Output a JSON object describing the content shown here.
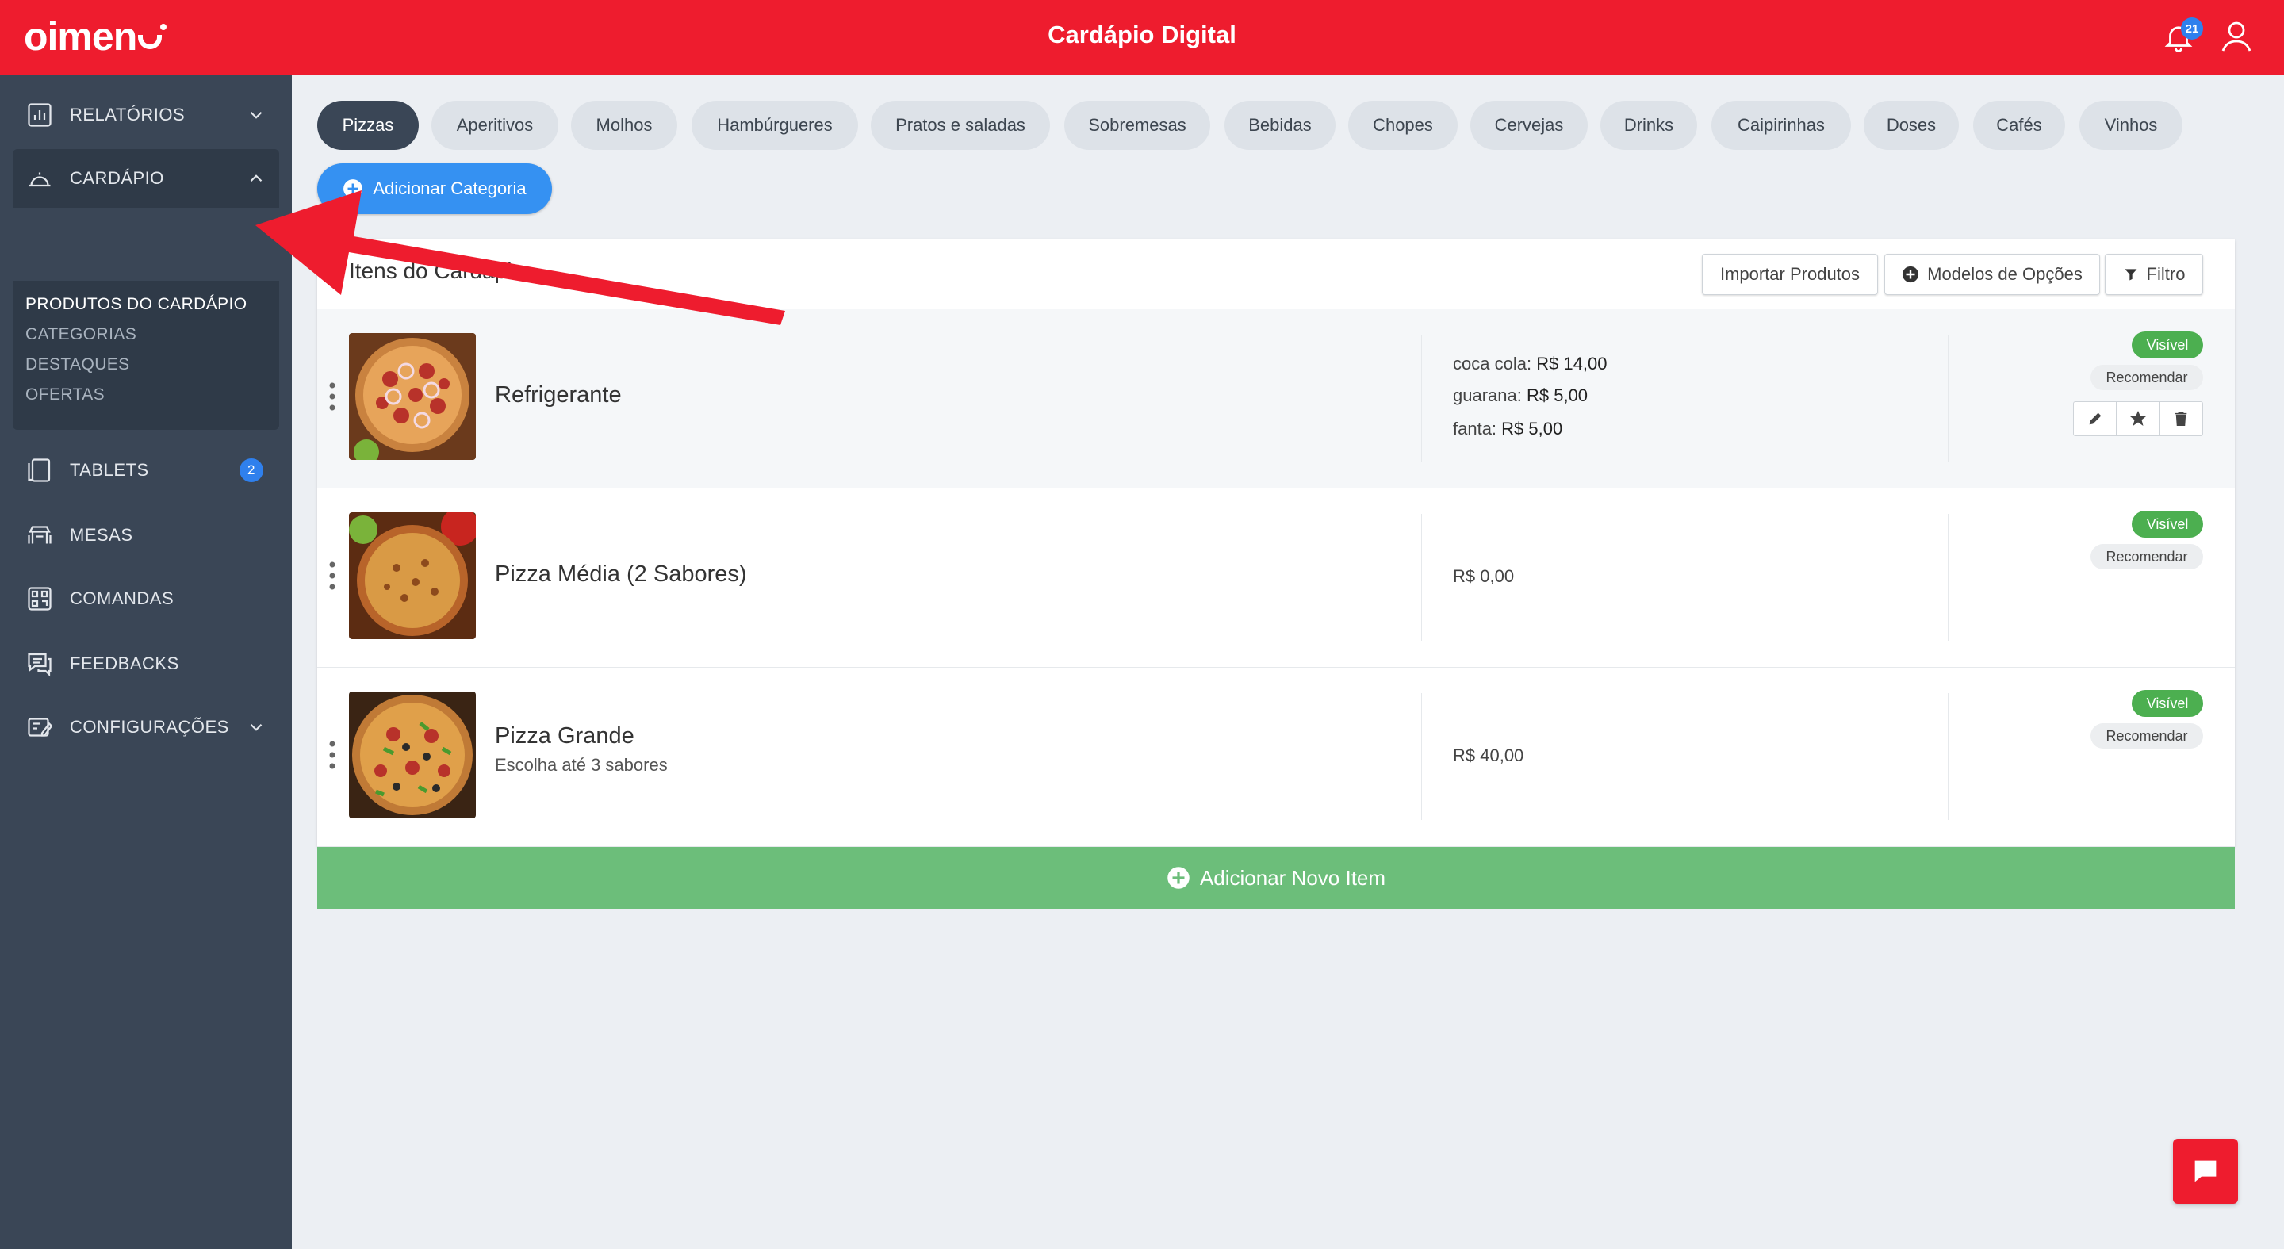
{
  "app": {
    "logo_text": "oimen",
    "title": "Cardápio Digital",
    "notification_count": "21"
  },
  "sidebar": {
    "items": [
      {
        "label": "RELATÓRIOS",
        "icon": "chart-icon"
      },
      {
        "label": "CARDÁPIO",
        "icon": "cloche-icon"
      },
      {
        "label": "TABLETS",
        "icon": "tablet-icon",
        "badge": "2"
      },
      {
        "label": "MESAS",
        "icon": "table-icon"
      },
      {
        "label": "COMANDAS",
        "icon": "qrcode-icon"
      },
      {
        "label": "FEEDBACKS",
        "icon": "chat-icon"
      },
      {
        "label": "CONFIGURAÇÕES",
        "icon": "settings-icon"
      }
    ],
    "subitems": [
      {
        "label": "PRODUTOS DO CARDÁPIO",
        "active": true
      },
      {
        "label": "CATEGORIAS"
      },
      {
        "label": "DESTAQUES"
      },
      {
        "label": "OFERTAS"
      }
    ]
  },
  "categories": [
    "Pizzas",
    "Aperitivos",
    "Molhos",
    "Hambúrgueres",
    "Pratos e saladas",
    "Sobremesas",
    "Bebidas",
    "Chopes",
    "Cervejas",
    "Drinks",
    "Caipirinhas",
    "Doses",
    "Cafés",
    "Vinhos"
  ],
  "add_category_label": "Adicionar Categoria",
  "card": {
    "title": "Itens do Cardápio",
    "buttons": {
      "import": "Importar Produtos",
      "models": "Modelos de Opções",
      "filter": "Filtro"
    }
  },
  "products": [
    {
      "name": "Refrigerante",
      "description": "",
      "prices": [
        {
          "label": "coca cola:",
          "value": "R$ 14,00"
        },
        {
          "label": "guarana:",
          "value": "R$ 5,00"
        },
        {
          "label": "fanta:",
          "value": "R$ 5,00"
        }
      ],
      "visible_label": "Visível",
      "recommend_label": "Recomendar"
    },
    {
      "name": "Pizza Média (2 Sabores)",
      "description": "",
      "price": "R$ 0,00",
      "visible_label": "Visível",
      "recommend_label": "Recomendar"
    },
    {
      "name": "Pizza Grande",
      "description": "Escolha até 3 sabores",
      "price": "R$ 40,00",
      "visible_label": "Visível",
      "recommend_label": "Recomendar"
    }
  ],
  "add_item_label": "Adicionar Novo Item",
  "colors": {
    "brand": "#ee1c2e",
    "sidebar": "#3a4656",
    "accent": "#3591f2",
    "success": "#4caf50",
    "add_item": "#6cbe7a"
  }
}
